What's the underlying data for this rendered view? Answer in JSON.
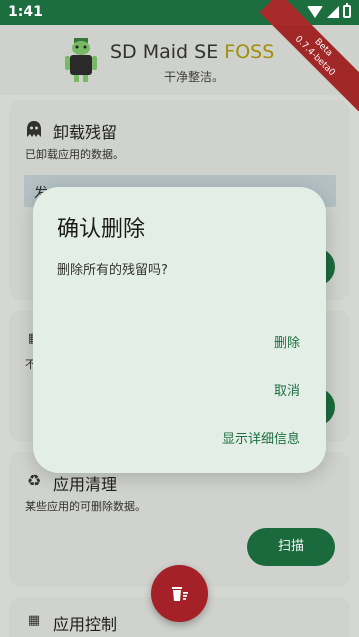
{
  "status_bar": {
    "time": "1:41"
  },
  "header": {
    "title": "SD Maid SE",
    "title_accent": "FOSS",
    "subtitle": "干净整洁。",
    "ribbon_line1": "Beta",
    "ribbon_line2": "0.7.4-beta0"
  },
  "cards": [
    {
      "icon": "ghost-icon",
      "title": "卸载残留",
      "description": "已卸载应用的数据。",
      "partial_text": "发"
    },
    {
      "icon": "grid-icon",
      "title": "",
      "description": "不"
    },
    {
      "icon": "recycle-icon",
      "title": "应用清理",
      "description": "某些应用的可删除数据。",
      "button_label": "扫描"
    },
    {
      "icon": "grid-icon",
      "title": "应用控制"
    }
  ],
  "dialog": {
    "title": "确认删除",
    "message": "删除所有的残留吗?",
    "actions": [
      "删除",
      "取消",
      "显示详细信息"
    ]
  },
  "fab": {
    "icon": "delete-list-icon"
  },
  "colors": {
    "primary": "#1c6e3f",
    "danger": "#a42127",
    "accent_yellow": "#a8930a",
    "dialog_bg": "#e3eee6"
  }
}
